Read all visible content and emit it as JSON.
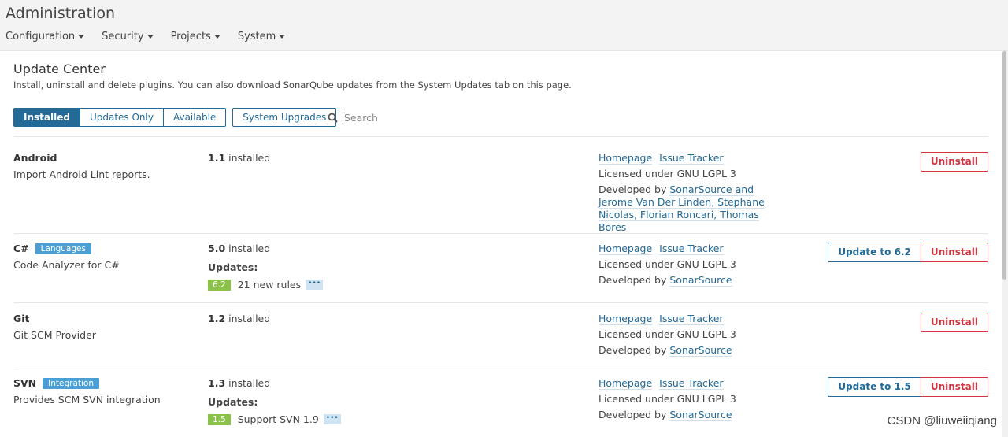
{
  "app_title": "Administration",
  "nav": [
    "Configuration",
    "Security",
    "Projects",
    "System"
  ],
  "page": {
    "title": "Update Center",
    "description": "Install, uninstall and delete plugins. You can also download SonarQube updates from the System Updates tab on this page."
  },
  "tabs": {
    "installed": "Installed",
    "updates_only": "Updates Only",
    "available": "Available",
    "system_upgrades": "System Upgrades",
    "active": "installed"
  },
  "search": {
    "placeholder": "Search",
    "value": ""
  },
  "plugins": [
    {
      "name": "Android",
      "badge": "",
      "description": "Import Android Lint reports.",
      "version": "1.1",
      "installed_suffix": "installed",
      "homepage": "Homepage",
      "issue_tracker": "Issue Tracker",
      "license": "Licensed under GNU LGPL 3",
      "developed_by": "Developed by",
      "developer_line1": "SonarSource and",
      "developer_line2": "Jerome Van Der Linden, Stephane",
      "developer_line3": "Nicolas, Florian Roncari, Thomas Bores",
      "uninstall": "Uninstall"
    },
    {
      "name": "C#",
      "badge": "Languages",
      "description": "Code Analyzer for C#",
      "version": "5.0",
      "installed_suffix": "installed",
      "updates_label": "Updates:",
      "update_version": "6.2",
      "update_note": "21 new rules",
      "more": "•••",
      "homepage": "Homepage",
      "issue_tracker": "Issue Tracker",
      "license": "Licensed under GNU LGPL 3",
      "developed_by": "Developed by",
      "developer": "SonarSource",
      "update_button": "Update to 6.2",
      "uninstall": "Uninstall"
    },
    {
      "name": "Git",
      "badge": "",
      "description": "Git SCM Provider",
      "version": "1.2",
      "installed_suffix": "installed",
      "homepage": "Homepage",
      "issue_tracker": "Issue Tracker",
      "license": "Licensed under GNU LGPL 3",
      "developed_by": "Developed by",
      "developer": "SonarSource",
      "uninstall": "Uninstall"
    },
    {
      "name": "SVN",
      "badge": "Integration",
      "description": "Provides SCM SVN integration",
      "version": "1.3",
      "installed_suffix": "installed",
      "updates_label": "Updates:",
      "update_version": "1.5",
      "update_note": "Support SVN 1.9",
      "more": "•••",
      "homepage": "Homepage",
      "issue_tracker": "Issue Tracker",
      "license": "Licensed under GNU LGPL 3",
      "developed_by": "Developed by",
      "developer": "SonarSource",
      "update_button": "Update to 1.5",
      "uninstall": "Uninstall"
    }
  ],
  "watermark": "CSDN @liuweiiqiang",
  "colors": {
    "primary": "#236a97",
    "danger": "#d4333f",
    "badge": "#4b9fd5",
    "update_badge": "#8bc34a"
  }
}
